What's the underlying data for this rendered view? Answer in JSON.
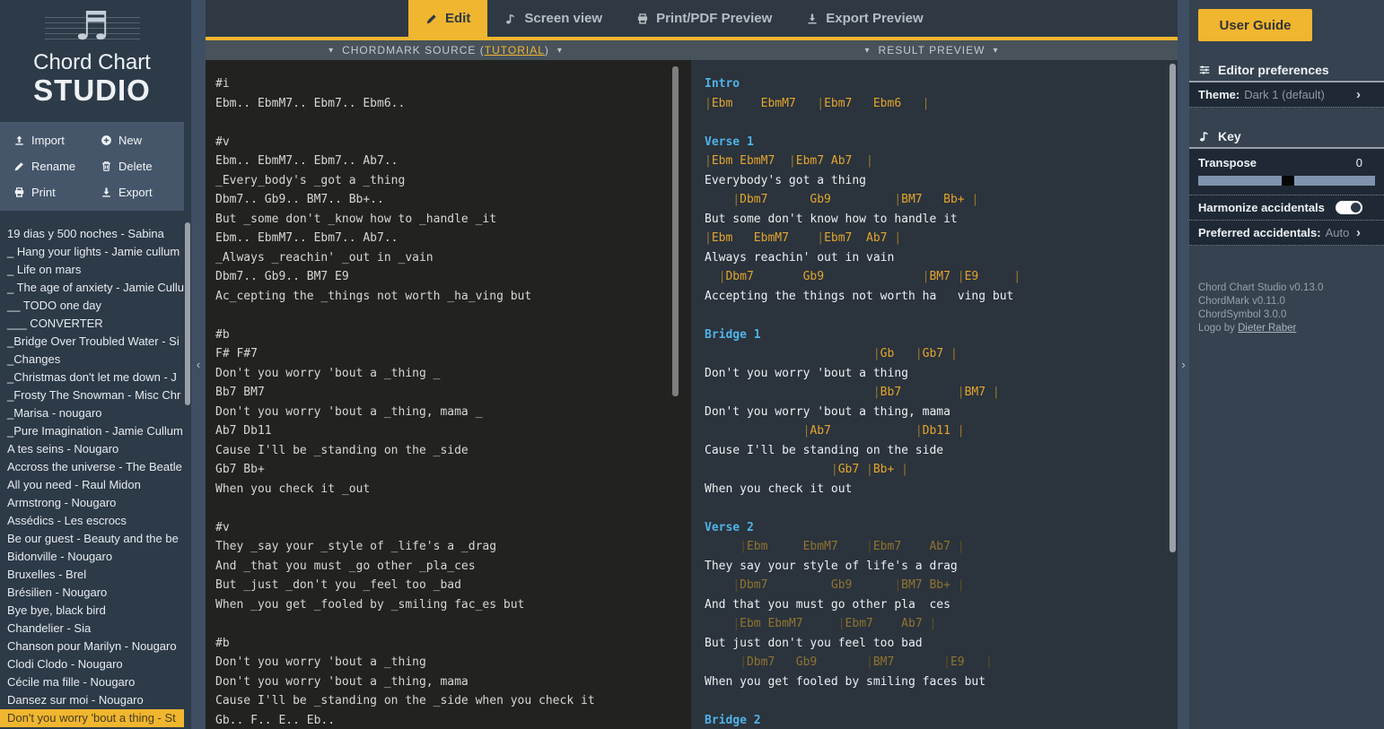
{
  "brand": {
    "line1": "Chord Chart",
    "line2": "STUDIO",
    "note_glyph": "♬"
  },
  "colors": {
    "accent": "#f0b62f",
    "chord": "#e2a52e",
    "section_heading": "#4fb3e8",
    "result_bg": "#2b333c",
    "source_bg": "#222221"
  },
  "tabs": {
    "items": [
      {
        "label": "Edit",
        "icon": "pencil-icon",
        "active": true
      },
      {
        "label": "Screen view",
        "icon": "note-icon",
        "active": false
      },
      {
        "label": "Print/PDF Preview",
        "icon": "printer-icon",
        "active": false
      },
      {
        "label": "Export Preview",
        "icon": "download-icon",
        "active": false
      }
    ]
  },
  "library": {
    "actions": [
      {
        "label": "Import",
        "icon": "upload-icon"
      },
      {
        "label": "New",
        "icon": "plus-icon"
      },
      {
        "label": "Rename",
        "icon": "pencil-icon"
      },
      {
        "label": "Delete",
        "icon": "trash-icon"
      },
      {
        "label": "Print",
        "icon": "printer-icon"
      },
      {
        "label": "Export",
        "icon": "download-icon"
      }
    ],
    "songs": [
      "19 dias y 500 noches - Sabina",
      "_ Hang your lights - Jamie cullum",
      "_ Life on mars",
      "_ The age of anxiety - Jamie Cullu",
      "__ TODO one day",
      "___ CONVERTER",
      "_Bridge Over Troubled Water - Si",
      "_Changes",
      "_Christmas don't let me down - J",
      "_Frosty The Snowman - Misc Chr",
      "_Marisa - nougaro",
      "_Pure Imagination - Jamie Cullum",
      "A tes seins - Nougaro",
      "Accross the universe - The Beatle",
      "All you need - Raul Midon",
      "Armstrong - Nougaro",
      "Assédics - Les escrocs",
      "Be our guest - Beauty and the be",
      "Bidonville - Nougaro",
      "Bruxelles - Brel",
      "Brésilien - Nougaro",
      "Bye bye, black bird",
      "Chandelier - Sia",
      "Chanson pour Marilyn - Nougaro",
      "Clodi Clodo - Nougaro",
      "Cécile ma fille - Nougaro",
      "Dansez sur moi - Nougaro",
      "Don't you worry 'bout a thing - St"
    ],
    "selected_index": 27
  },
  "source_panel": {
    "header_prefix": "CHORDMARK SOURCE (",
    "header_link": "TUTORIAL",
    "header_suffix": ")",
    "caret": "▾",
    "lines": [
      "#i",
      "Ebm.. EbmM7.. Ebm7.. Ebm6..",
      "",
      "#v",
      "Ebm.. EbmM7.. Ebm7.. Ab7..",
      "_Every_body's _got a _thing",
      "Dbm7.. Gb9.. BM7.. Bb+..",
      "But _some don't _know how to _handle _it",
      "Ebm.. EbmM7.. Ebm7.. Ab7..",
      "_Always _reachin' _out in _vain",
      "Dbm7.. Gb9.. BM7 E9",
      "Ac_cepting the _things not worth _ha_ving but",
      "",
      "#b",
      "F# F#7",
      "Don't you worry 'bout a _thing _",
      "Bb7 BM7",
      "Don't you worry 'bout a _thing, mama _",
      "Ab7 Db11",
      "Cause I'll be _standing on the _side",
      "Gb7 Bb+",
      "When you check it _out",
      "",
      "#v",
      "They _say your _style of _life's a _drag",
      "And _that you must _go other _pla_ces",
      "But _just _don't you _feel too _bad",
      "When _you get _fooled by _smiling fac_es but",
      "",
      "#b",
      "Don't you worry 'bout a _thing",
      "Don't you worry 'bout a _thing, mama",
      "Cause I'll be _standing on the _side when you check it",
      "Gb.. F.. E.. Eb.."
    ]
  },
  "result_panel": {
    "header": "RESULT PREVIEW",
    "caret": "▾",
    "lines": [
      {
        "t": "h",
        "s": "Intro"
      },
      {
        "t": "c",
        "s": "|Ebm    EbmM7   |Ebm7   Ebm6   |"
      },
      {
        "t": "x",
        "s": ""
      },
      {
        "t": "h",
        "s": "Verse 1"
      },
      {
        "t": "c",
        "s": "|Ebm EbmM7  |Ebm7 Ab7  |"
      },
      {
        "t": "l",
        "s": "Everybody's got a thing"
      },
      {
        "t": "c",
        "s": "    |Dbm7      Gb9         |BM7   Bb+ |"
      },
      {
        "t": "l",
        "s": "But some don't know how to handle it"
      },
      {
        "t": "c",
        "s": "|Ebm   EbmM7    |Ebm7  Ab7 |"
      },
      {
        "t": "l",
        "s": "Always reachin' out in vain"
      },
      {
        "t": "c",
        "s": "  |Dbm7       Gb9              |BM7 |E9     |"
      },
      {
        "t": "l",
        "s": "Accepting the things not worth ha   ving but"
      },
      {
        "t": "x",
        "s": ""
      },
      {
        "t": "h",
        "s": "Bridge 1"
      },
      {
        "t": "c",
        "s": "                        |Gb   |Gb7 |"
      },
      {
        "t": "l",
        "s": "Don't you worry 'bout a thing"
      },
      {
        "t": "c",
        "s": "                        |Bb7        |BM7 |"
      },
      {
        "t": "l",
        "s": "Don't you worry 'bout a thing, mama"
      },
      {
        "t": "c",
        "s": "              |Ab7            |Db11 |"
      },
      {
        "t": "l",
        "s": "Cause I'll be standing on the side"
      },
      {
        "t": "c",
        "s": "                  |Gb7 |Bb+ |"
      },
      {
        "t": "l",
        "s": "When you check it out"
      },
      {
        "t": "x",
        "s": ""
      },
      {
        "t": "h",
        "s": "Verse 2"
      },
      {
        "t": "cd",
        "s": "     |Ebm     EbmM7    |Ebm7    Ab7 |"
      },
      {
        "t": "l",
        "s": "They say your style of life's a drag"
      },
      {
        "t": "cd",
        "s": "    |Dbm7         Gb9      |BM7 Bb+ |"
      },
      {
        "t": "l",
        "s": "And that you must go other pla  ces"
      },
      {
        "t": "cd",
        "s": "    |Ebm EbmM7     |Ebm7    Ab7 |"
      },
      {
        "t": "l",
        "s": "But just don't you feel too bad"
      },
      {
        "t": "cd",
        "s": "     |Dbm7   Gb9       |BM7       |E9   |"
      },
      {
        "t": "l",
        "s": "When you get fooled by smiling faces but"
      },
      {
        "t": "x",
        "s": ""
      },
      {
        "t": "h",
        "s": "Bridge 2"
      }
    ]
  },
  "right_panel": {
    "user_guide": "User Guide",
    "prefs_title": "Editor preferences",
    "theme_label": "Theme:",
    "theme_value": "Dark 1 (default)",
    "key_title": "Key",
    "transpose_label": "Transpose",
    "transpose_value": "0",
    "harmonize_label": "Harmonize accidentals",
    "preferred_label": "Preferred accidentals:",
    "preferred_value": "Auto",
    "chevron": "›",
    "footer_lines": [
      "Chord Chart Studio v0.13.0",
      "ChordMark v0.11.0",
      "ChordSymbol 3.0.0"
    ],
    "credit_prefix": "Logo by ",
    "credit_link": "Dieter Raber"
  },
  "collapse": {
    "left": "‹",
    "right": "›"
  }
}
